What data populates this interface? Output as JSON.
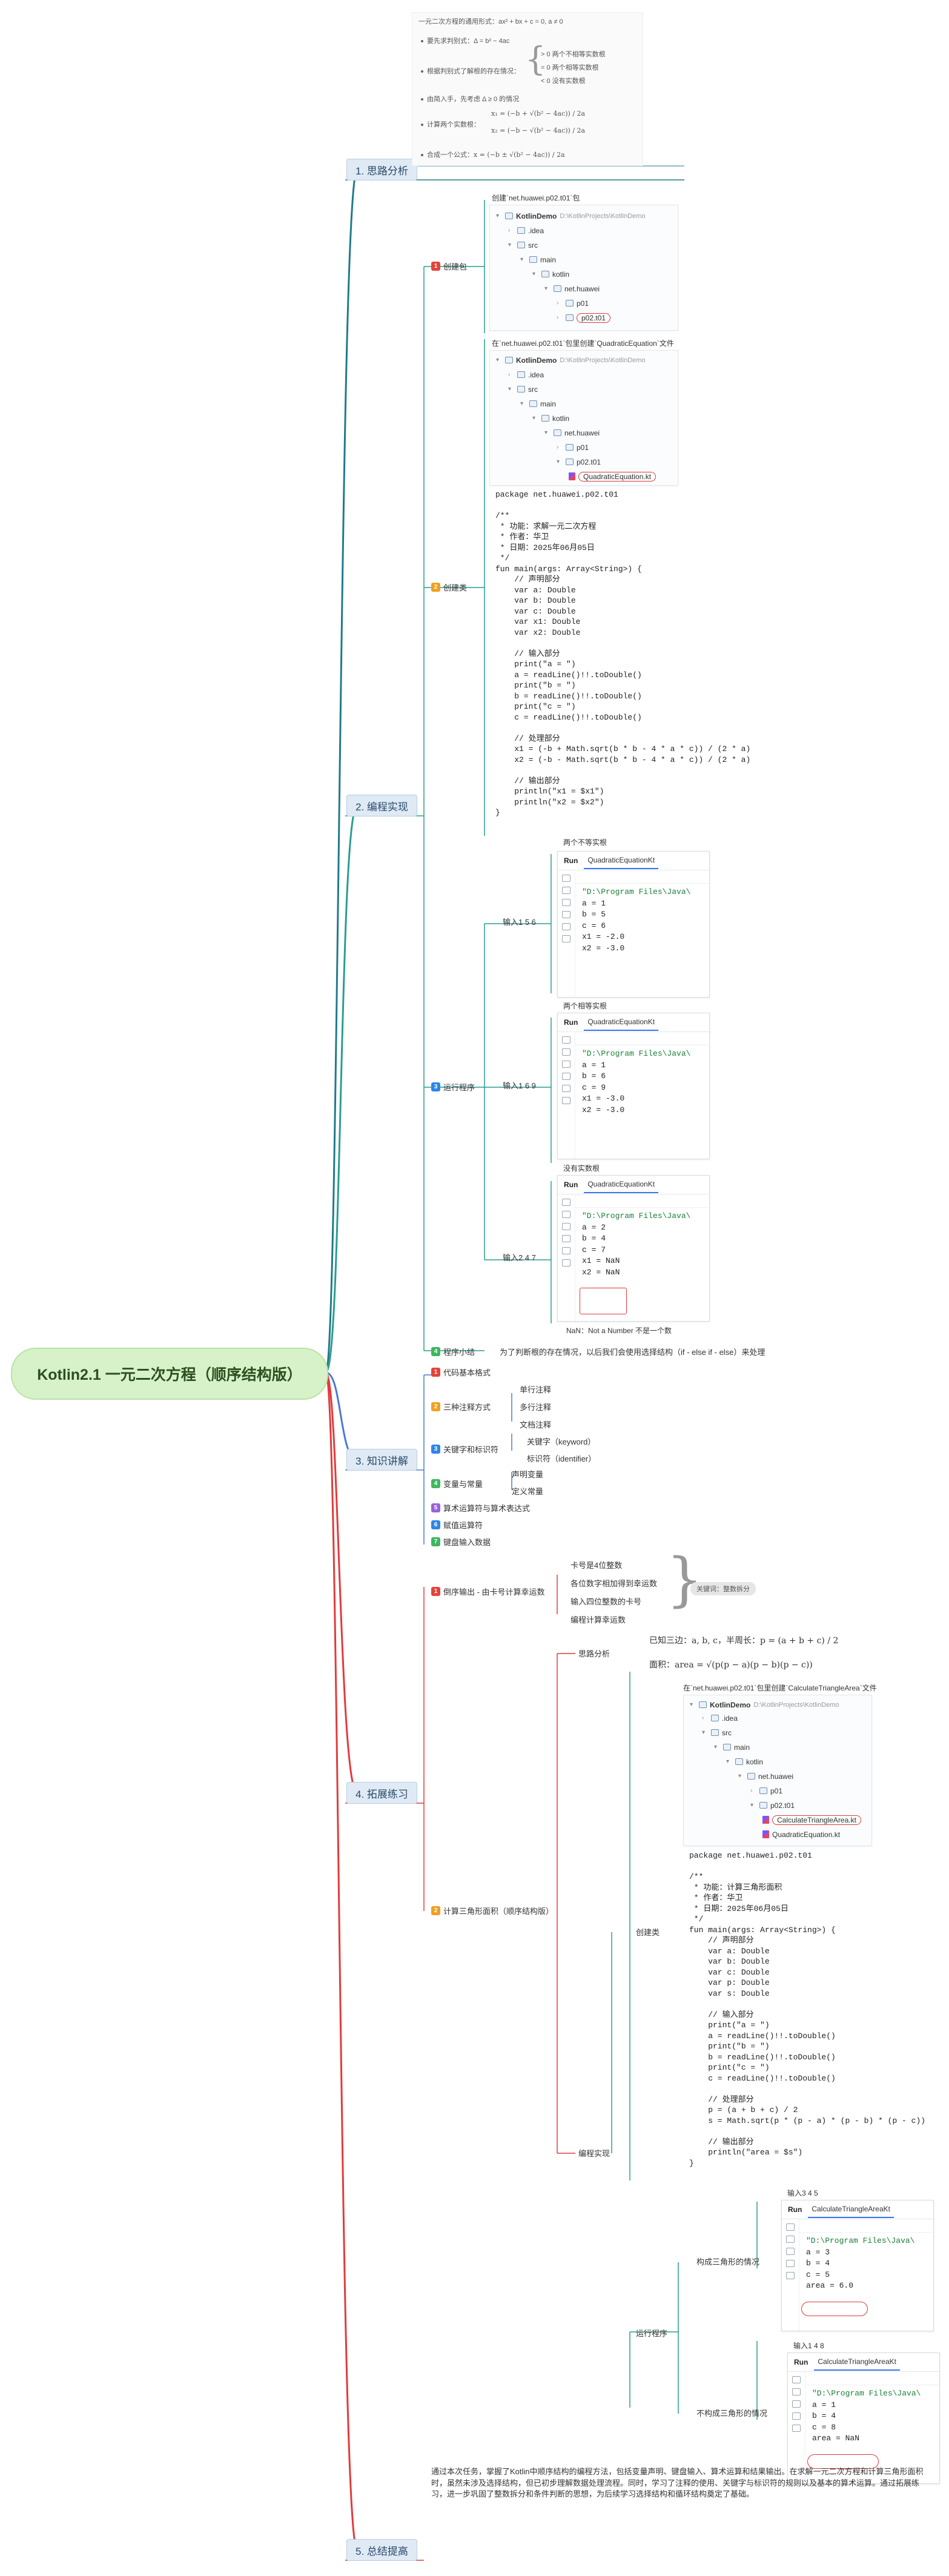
{
  "root": "Kotlin2.1 一元二次方程（顺序结构版）",
  "sections": {
    "s1": "1. 思路分析",
    "s2": "2. 编程实现",
    "s3": "3. 知识讲解",
    "s4": "4. 拓展练习",
    "s5": "5. 总结提高"
  },
  "analysis": {
    "l1": "一元二次方程的通用形式：ax² + bx + c = 0, a ≠ 0",
    "l2": "要先求判别式：Δ = b² − 4ac",
    "l3": "根据判别式了解根的存在情况：",
    "l3a": "> 0  两个不相等实数根",
    "l3b": "= 0  两个相等实数根",
    "l3c": "< 0  没有实数根",
    "l4": "由简入手，先考虑 Δ ≥ 0 的情况",
    "l5": "计算两个实数根：",
    "l5a": "x₁ = (−b + √(b² − 4ac)) / 2a",
    "l5b": "x₂ = (−b − √(b² − 4ac)) / 2a",
    "l6": "合成一个公式：x = (−b ± √(b² − 4ac)) / 2a"
  },
  "impl": {
    "pkg_label": "创建包",
    "pkg_caption": "创建`net.huawei.p02.t01`包",
    "prog_label": "创建类",
    "prog_caption": "在`net.huawei.p02.t01`包里创建`QuadraticEquation`文件",
    "run_label": "运行程序",
    "summary_label": "程序小结",
    "summary_text": "为了判断根的存在情况，以后我们会使用选择结构（if - else if - else）来处理"
  },
  "tree1": {
    "project": "KotlinDemo",
    "project_path": "D:\\KotlinProjects\\KotlinDemo",
    "items": [
      ".idea",
      "src",
      "main",
      "kotlin",
      "net.huawei",
      "p01",
      "p02.t01"
    ]
  },
  "tree2": {
    "project": "KotlinDemo",
    "project_path": "D:\\KotlinProjects\\KotlinDemo",
    "items": [
      ".idea",
      "src",
      "main",
      "kotlin",
      "net.huawei",
      "p01",
      "p02.t01",
      "QuadraticEquation.kt"
    ]
  },
  "code1": "package net.huawei.p02.t01\n\n/**\n * 功能：求解一元二次方程\n * 作者：华卫\n * 日期：2025年06月05日\n */\nfun main(args: Array<String>) {\n    // 声明部分\n    var a: Double\n    var b: Double\n    var c: Double\n    var x1: Double\n    var x2: Double\n\n    // 输入部分\n    print(\"a = \")\n    a = readLine()!!.toDouble()\n    print(\"b = \")\n    b = readLine()!!.toDouble()\n    print(\"c = \")\n    c = readLine()!!.toDouble()\n\n    // 处理部分\n    x1 = (-b + Math.sqrt(b * b - 4 * a * c)) / (2 * a)\n    x2 = (-b - Math.sqrt(b * b - 4 * a * c)) / (2 * a)\n\n    // 输出部分\n    println(\"x1 = $x1\")\n    println(\"x2 = $x2\")\n}",
  "runs": [
    {
      "input_label": "输入1 5 6",
      "caption": "两个不等实根",
      "tab": "QuadraticEquationKt",
      "path": "\"D:\\Program Files\\Java\\",
      "lines": [
        "a = 1",
        "b = 5",
        "c = 6",
        "x1 = -2.0",
        "x2 = -3.0"
      ]
    },
    {
      "input_label": "输入1 6 9",
      "caption": "两个相等实根",
      "tab": "QuadraticEquationKt",
      "path": "\"D:\\Program Files\\Java\\",
      "lines": [
        "a = 1",
        "b = 6",
        "c = 9",
        "x1 = -3.0",
        "x2 = -3.0"
      ]
    },
    {
      "input_label": "输入2 4 7",
      "caption": "没有实数根",
      "tab": "QuadraticEquationKt",
      "path": "\"D:\\Program Files\\Java\\",
      "lines": [
        "a = 2",
        "b = 4",
        "c = 7",
        "x1 = NaN",
        "x2 = NaN"
      ]
    }
  ],
  "run_tab_label": "Run",
  "nan_note": "NaN：Not a Number 不是一个数",
  "knowledge": {
    "k1": "代码基本格式",
    "k2": "三种注释方式",
    "k2a": "单行注释",
    "k2b": "多行注释",
    "k2c": "文档注释",
    "k3": "关键字和标识符",
    "k3a": "关键字（keyword）",
    "k3b": "标识符（identifier）",
    "k4": "变量与常量",
    "k4a": "声明变量",
    "k4b": "定义常量",
    "k5": "算术运算符与算术表达式",
    "k6": "赋值运算符",
    "k7": "键盘输入数据"
  },
  "practice": {
    "p1": "倒序输出 - 由卡号计算幸运数",
    "p1a": "卡号是4位整数",
    "p1b": "各位数字相加得到幸运数",
    "p1c": "输入四位整数的卡号",
    "p1d": "编程计算幸运数",
    "p1_note": "关键词：整数拆分",
    "p2": "计算三角形面积（顺序结构版）",
    "think": "思路分析",
    "formula_a": "已知三边：a, b, c，半周长：p = (a + b + c) / 2",
    "formula_b": "面积：area = √(p(p − a)(p − b)(p − c))",
    "code_impl": "编程实现",
    "create_class": "创建类",
    "create_caption": "在`net.huawei.p02.t01`包里创建`CalculateTriangleArea`文件",
    "run_prog": "运行程序",
    "tri_ok": "构成三角形的情况",
    "tri_no": "不构成三角形的情况",
    "in1": "输入3 4 5",
    "in2": "输入1 4 8"
  },
  "tree3": {
    "project": "KotlinDemo",
    "project_path": "D:\\KotlinProjects\\KotlinDemo",
    "items": [
      ".idea",
      "src",
      "main",
      "kotlin",
      "net.huawei",
      "p01",
      "p02.t01",
      "CalculateTriangleArea.kt",
      "QuadraticEquation.kt"
    ]
  },
  "code2": "package net.huawei.p02.t01\n\n/**\n * 功能：计算三角形面积\n * 作者：华卫\n * 日期：2025年06月05日\n */\nfun main(args: Array<String>) {\n    // 声明部分\n    var a: Double\n    var b: Double\n    var c: Double\n    var p: Double\n    var s: Double\n\n    // 输入部分\n    print(\"a = \")\n    a = readLine()!!.toDouble()\n    print(\"b = \")\n    b = readLine()!!.toDouble()\n    print(\"c = \")\n    c = readLine()!!.toDouble()\n\n    // 处理部分\n    p = (a + b + c) / 2\n    s = Math.sqrt(p * (p - a) * (p - b) * (p - c))\n\n    // 输出部分\n    println(\"area = $s\")\n}",
  "runs2": [
    {
      "tab": "CalculateTriangleAreaKt",
      "path": "\"D:\\Program Files\\Java\\",
      "lines": [
        "a = 3",
        "b = 4",
        "c = 5",
        "area = 6.0"
      ]
    },
    {
      "tab": "CalculateTriangleAreaKt",
      "path": "\"D:\\Program Files\\Java\\",
      "lines": [
        "a = 1",
        "b = 4",
        "c = 8",
        "area = NaN"
      ]
    }
  ],
  "summary": "通过本次任务，掌握了Kotlin中顺序结构的编程方法，包括变量声明、键盘输入、算术运算和结果输出。在求解一元二次方程和计算三角形面积时，虽然未涉及选择结构，但已初步理解数据处理流程。同时，学习了注释的使用、关键字与标识符的规则以及基本的算术运算。通过拓展练习，进一步巩固了整数拆分和条件判断的思想，为后续学习选择结构和循环结构奠定了基础。",
  "colors": {
    "root": "#d7f2c9",
    "sec": "#dfeaf5",
    "branch_s2": "#2a9d8f",
    "branch_s4": "#e23a3a",
    "branch_s1": "#1f7a8c",
    "branch_s3": "#4b7bd0"
  }
}
